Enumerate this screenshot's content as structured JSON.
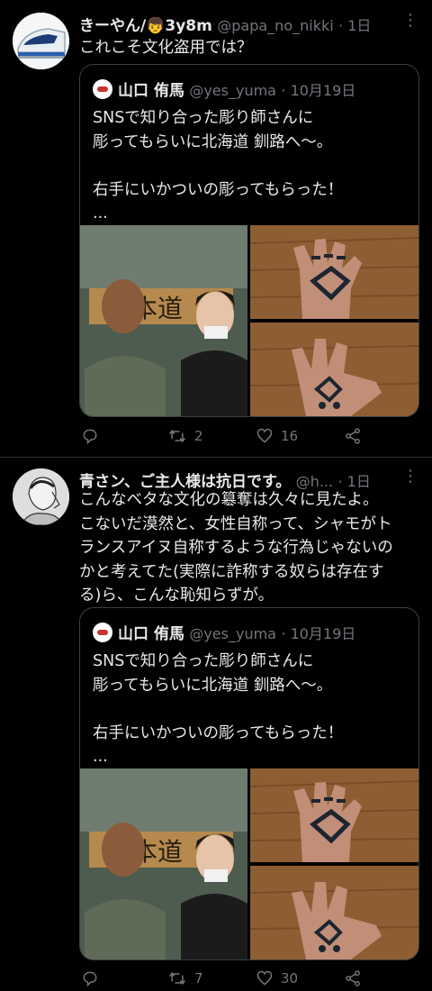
{
  "tweets": [
    {
      "author_name": "きーやん/👦3y8m",
      "handle": "@papa_no_nikki",
      "time": "· 1日",
      "text": "これこそ文化盗用では？",
      "quote": {
        "author_name": "山口 侑馬",
        "handle": "@yes_yuma",
        "time": "· 10月19日",
        "text": "SNSで知り合った彫り師さんに\n彫ってもらいに北海道 釧路へ〜。\n\n右手にいかついの彫ってもらった！\n..."
      },
      "replies": "",
      "retweets": "2",
      "likes": "16"
    },
    {
      "author_name": "青さン、ご主人様は抗日です。",
      "handle": "@h...",
      "time": "· 1日",
      "text": "こんなベタな文化の簒奪は久々に見たよ。\nこないだ漠然と、女性自称って、シャモがト\nランスアイヌ自称するような行為じゃないの\nかと考えてた(実際に詐称する奴らは存在す\nる)ら、こんな恥知らずが。",
      "quote": {
        "author_name": "山口 侑馬",
        "handle": "@yes_yuma",
        "time": "· 10月19日",
        "text": "SNSで知り合った彫り師さんに\n彫ってもらいに北海道 釧路へ〜。\n\n右手にいかついの彫ってもらった！\n..."
      },
      "replies": "",
      "retweets": "7",
      "likes": "30"
    }
  ],
  "photo_sign": "本道",
  "icons": {
    "reply": "reply-icon",
    "retweet": "retweet-icon",
    "like": "heart-icon",
    "share": "share-icon",
    "more": "more-icon"
  },
  "colors": {
    "background": "#000000",
    "text": "#e7e9ea",
    "secondary": "#71767b",
    "border": "#2f3336"
  }
}
